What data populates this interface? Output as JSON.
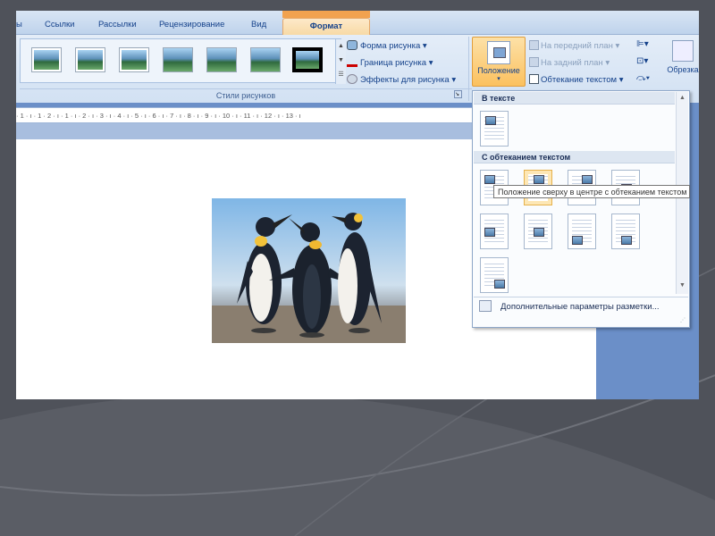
{
  "tabs": [
    {
      "label": "ы"
    },
    {
      "label": "Ссылки"
    },
    {
      "label": "Рассылки"
    },
    {
      "label": "Рецензирование"
    },
    {
      "label": "Вид"
    }
  ],
  "active_tab": {
    "label": "Формат"
  },
  "ribbon": {
    "picture_styles_group": {
      "label": "Стили рисунков",
      "commands": {
        "shape": "Форма рисунка",
        "border": "Граница рисунка",
        "effects": "Эффекты для рисунка"
      }
    },
    "arrange_group": {
      "position_button": "Положение",
      "bring_front": "На передний план",
      "send_back": "На задний план",
      "text_wrap": "Обтекание текстом"
    },
    "crop_button": "Обрезка"
  },
  "ruler": {
    "text": "· 1 · ı · 1 · 2 · ı · 1 · ı · 2 · ı · 3 · ı · 4 · ı · 5 · ı · 6 · ı · 7 · ı · 8 · ı · 9 · ı · 10 · ı · 11 · ı · 12 · ı · 13 · ı"
  },
  "position_menu": {
    "section_in_text": "В тексте",
    "section_wrap": "С обтеканием текстом",
    "more_options": "Дополнительные параметры разметки...",
    "tooltip": "Положение сверху в центре с обтеканием текстом"
  },
  "colors": {
    "active_tab": "#f7d9a4",
    "ribbon_bg": "#d2e1f3",
    "label_blue": "#15428b"
  }
}
